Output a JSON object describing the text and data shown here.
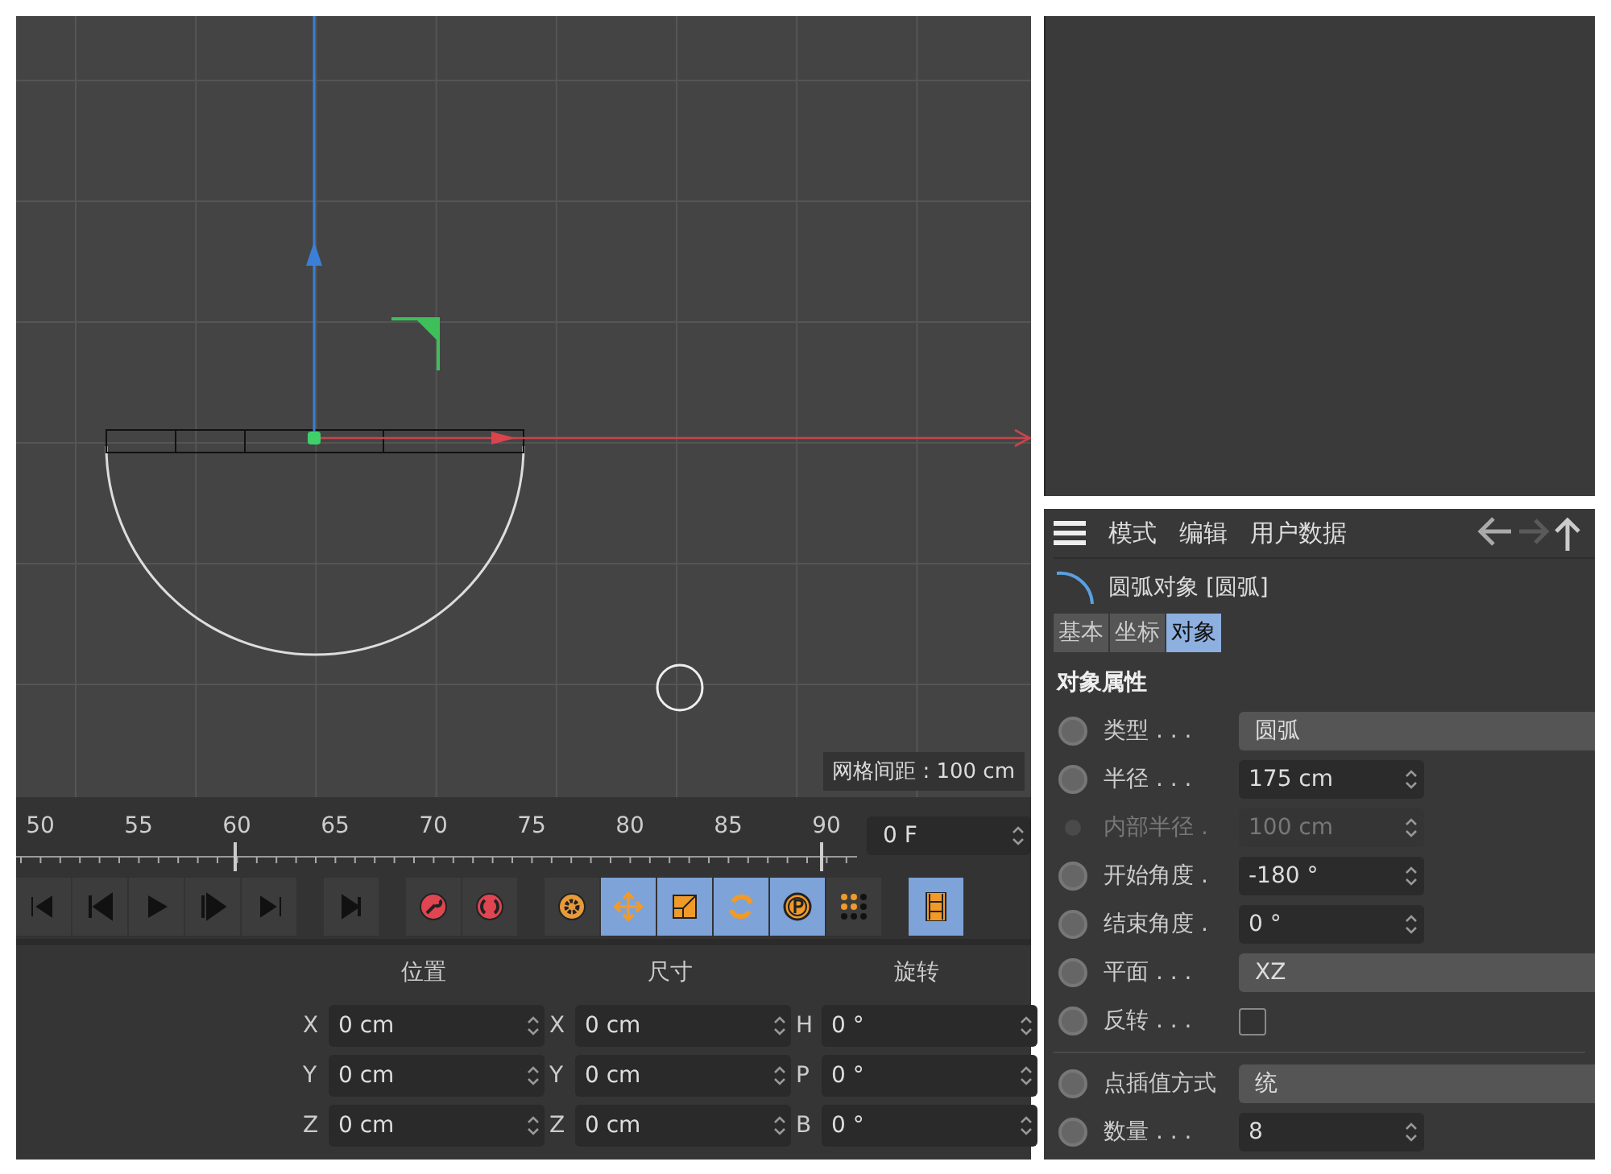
{
  "viewport": {
    "grid_label": "网格间距 : 100 cm"
  },
  "timeline": {
    "ticks": [
      "50",
      "55",
      "60",
      "65",
      "70",
      "75",
      "80",
      "85",
      "90"
    ],
    "frame": "0 F"
  },
  "tools": [
    {
      "kind": "key",
      "selected": false
    },
    {
      "kind": "autokey",
      "selected": false
    },
    {
      "kind": "gear",
      "selected": false
    },
    {
      "kind": "move",
      "selected": true
    },
    {
      "kind": "scale",
      "selected": true
    },
    {
      "kind": "rotate",
      "selected": true
    },
    {
      "kind": "param",
      "selected": true
    },
    {
      "kind": "dots",
      "selected": false
    },
    {
      "kind": "film",
      "selected": true
    }
  ],
  "coordinates": {
    "columns": [
      "位置",
      "尺寸",
      "旋转"
    ],
    "rows": [
      [
        {
          "axis": "X",
          "value": "0 cm"
        },
        {
          "axis": "X",
          "value": "0 cm"
        },
        {
          "axis": "H",
          "value": "0 °"
        }
      ],
      [
        {
          "axis": "Y",
          "value": "0 cm"
        },
        {
          "axis": "Y",
          "value": "0 cm"
        },
        {
          "axis": "P",
          "value": "0 °"
        }
      ],
      [
        {
          "axis": "Z",
          "value": "0 cm"
        },
        {
          "axis": "Z",
          "value": "0 cm"
        },
        {
          "axis": "B",
          "value": "0 °"
        }
      ]
    ]
  },
  "attributes": {
    "menu": [
      "模式",
      "编辑",
      "用户数据"
    ],
    "object_title": "圆弧对象 [圆弧]",
    "tabs": [
      {
        "label": "基本",
        "selected": false
      },
      {
        "label": "坐标",
        "selected": false
      },
      {
        "label": "对象",
        "selected": true
      }
    ],
    "section": "对象属性",
    "params": [
      {
        "kind": "dropdown",
        "label": "类型 . . .",
        "value": "圆弧",
        "disabled": false
      },
      {
        "kind": "number",
        "label": "半径 . . .",
        "value": "175 cm",
        "disabled": false
      },
      {
        "kind": "number",
        "label": "内部半径 .",
        "value": "100 cm",
        "disabled": true
      },
      {
        "kind": "number",
        "label": "开始角度 .",
        "value": "-180 °",
        "disabled": false
      },
      {
        "kind": "number",
        "label": "结束角度 .",
        "value": "0 °",
        "disabled": false
      },
      {
        "kind": "dropdown",
        "label": "平面 . . .",
        "value": "XZ",
        "disabled": false
      },
      {
        "kind": "checkbox",
        "label": "反转 . . .",
        "checked": false,
        "disabled": false
      },
      {
        "kind": "divider"
      },
      {
        "kind": "dropdown",
        "label": "点插值方式",
        "value": "统",
        "disabled": false
      },
      {
        "kind": "number",
        "label": "数量 . . .",
        "value": "8",
        "disabled": false
      }
    ]
  }
}
